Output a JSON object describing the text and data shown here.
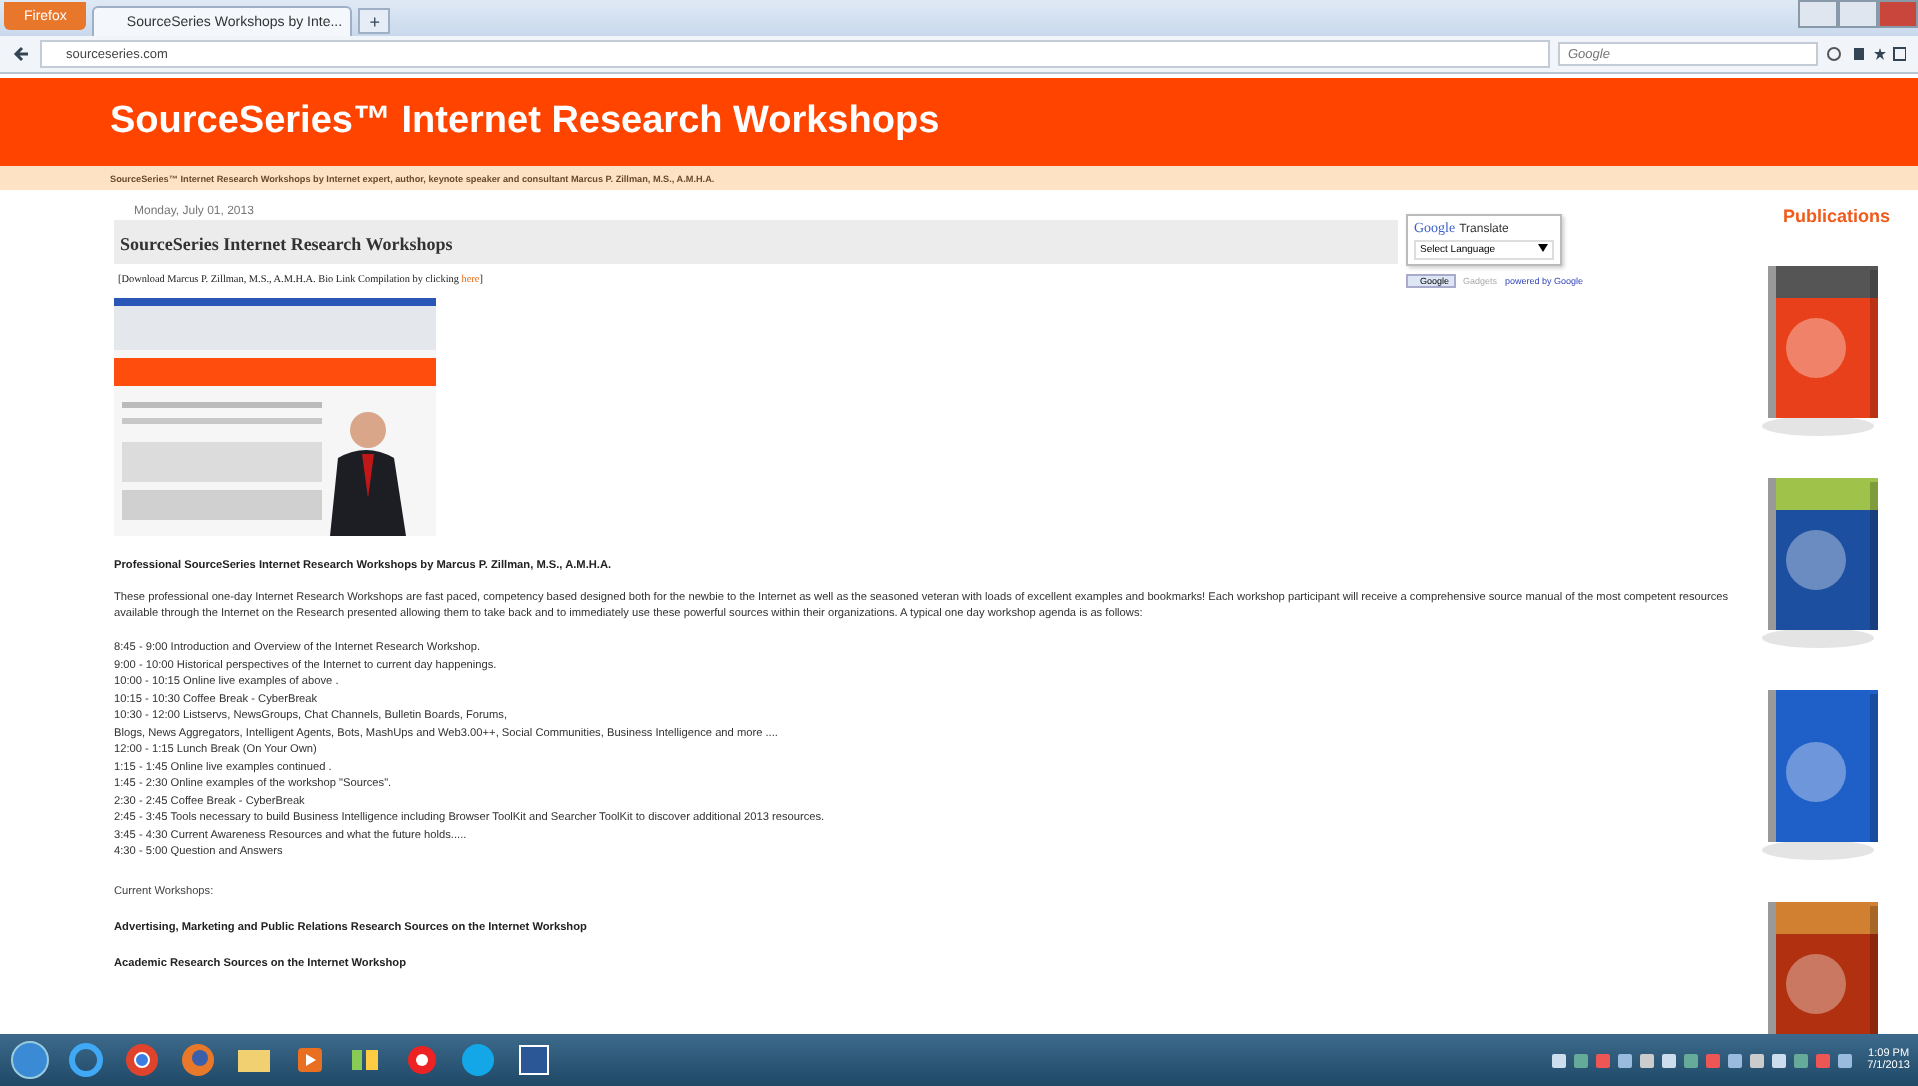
{
  "browser": {
    "menu_button": "Firefox",
    "tabs": [
      {
        "title": "SourceSeries Workshops by Inte...",
        "selected": true
      }
    ],
    "new_tab": "+",
    "url": "sourceseries.com",
    "search_placeholder": "Google"
  },
  "site": {
    "title": "SourceSeries™ Internet Research Workshops",
    "tagline": "SourceSeries™ Internet Research Workshops by Internet expert, author, keynote speaker and consultant Marcus P. Zillman, M.S., A.M.H.A."
  },
  "post": {
    "date": "Monday, July 01, 2013",
    "title": "SourceSeries Internet Research Workshops",
    "download_text": "[Download Marcus P. Zillman, M.S., A.M.H.A. Bio Link Compilation by clicking ",
    "download_link": "here",
    "download_end": "]",
    "heading": "Professional SourceSeries Internet Research Workshops by Marcus P. Zillman, M.S., A.M.H.A.",
    "intro": "These professional one-day Internet Research Workshops are fast paced, competency based designed both for the newbie to the Internet as well as the seasoned veteran with loads of excellent examples and bookmarks! Each workshop participant will receive a comprehensive source manual of the most competent resources available through the Internet on the Research presented allowing them to take back and to immediately use these powerful sources within their organizations. A typical one day workshop agenda is as follows:",
    "schedule": [
      "8:45 - 9:00 Introduction and Overview of the Internet Research Workshop.",
      "9:00 - 10:00 Historical perspectives of the Internet to current day happenings.",
      "10:00 - 10:15 Online live examples of above .",
      "10:15 - 10:30 Coffee Break - CyberBreak",
      "10:30 - 12:00 Listservs, NewsGroups, Chat Channels, Bulletin Boards, Forums,",
      "Blogs, News Aggregators, Intelligent Agents, Bots, MashUps and Web3.00++, Social Communities, Business Intelligence and more ....",
      "12:00 - 1:15 Lunch Break (On Your Own)",
      "1:15 - 1:45 Online live examples continued .",
      "1:45 - 2:30 Online examples of the workshop \"Sources\".",
      "2:30 - 2:45 Coffee Break - CyberBreak",
      "2:45 - 3:45 Tools necessary to build Business Intelligence including Browser ToolKit and Searcher ToolKit to discover additional 2013 resources.",
      "3:45 - 4:30 Current Awareness Resources and what the future holds.....",
      "4:30 - 5:00 Question and Answers"
    ],
    "current_label": "Current Workshops:",
    "workshops": [
      "Advertising, Marketing and Public Relations Research Sources on the Internet Workshop",
      "Academic Research Sources on the Internet Workshop"
    ]
  },
  "translate": {
    "logo": "Google",
    "label": "Translate",
    "select": "Select Language",
    "gadget_button": "Google",
    "gadgets": "Gadgets",
    "powered": "powered by Google"
  },
  "publications": {
    "title": "Publications"
  },
  "taskbar": {
    "time": "1:09 PM",
    "date": "7/1/2013"
  }
}
